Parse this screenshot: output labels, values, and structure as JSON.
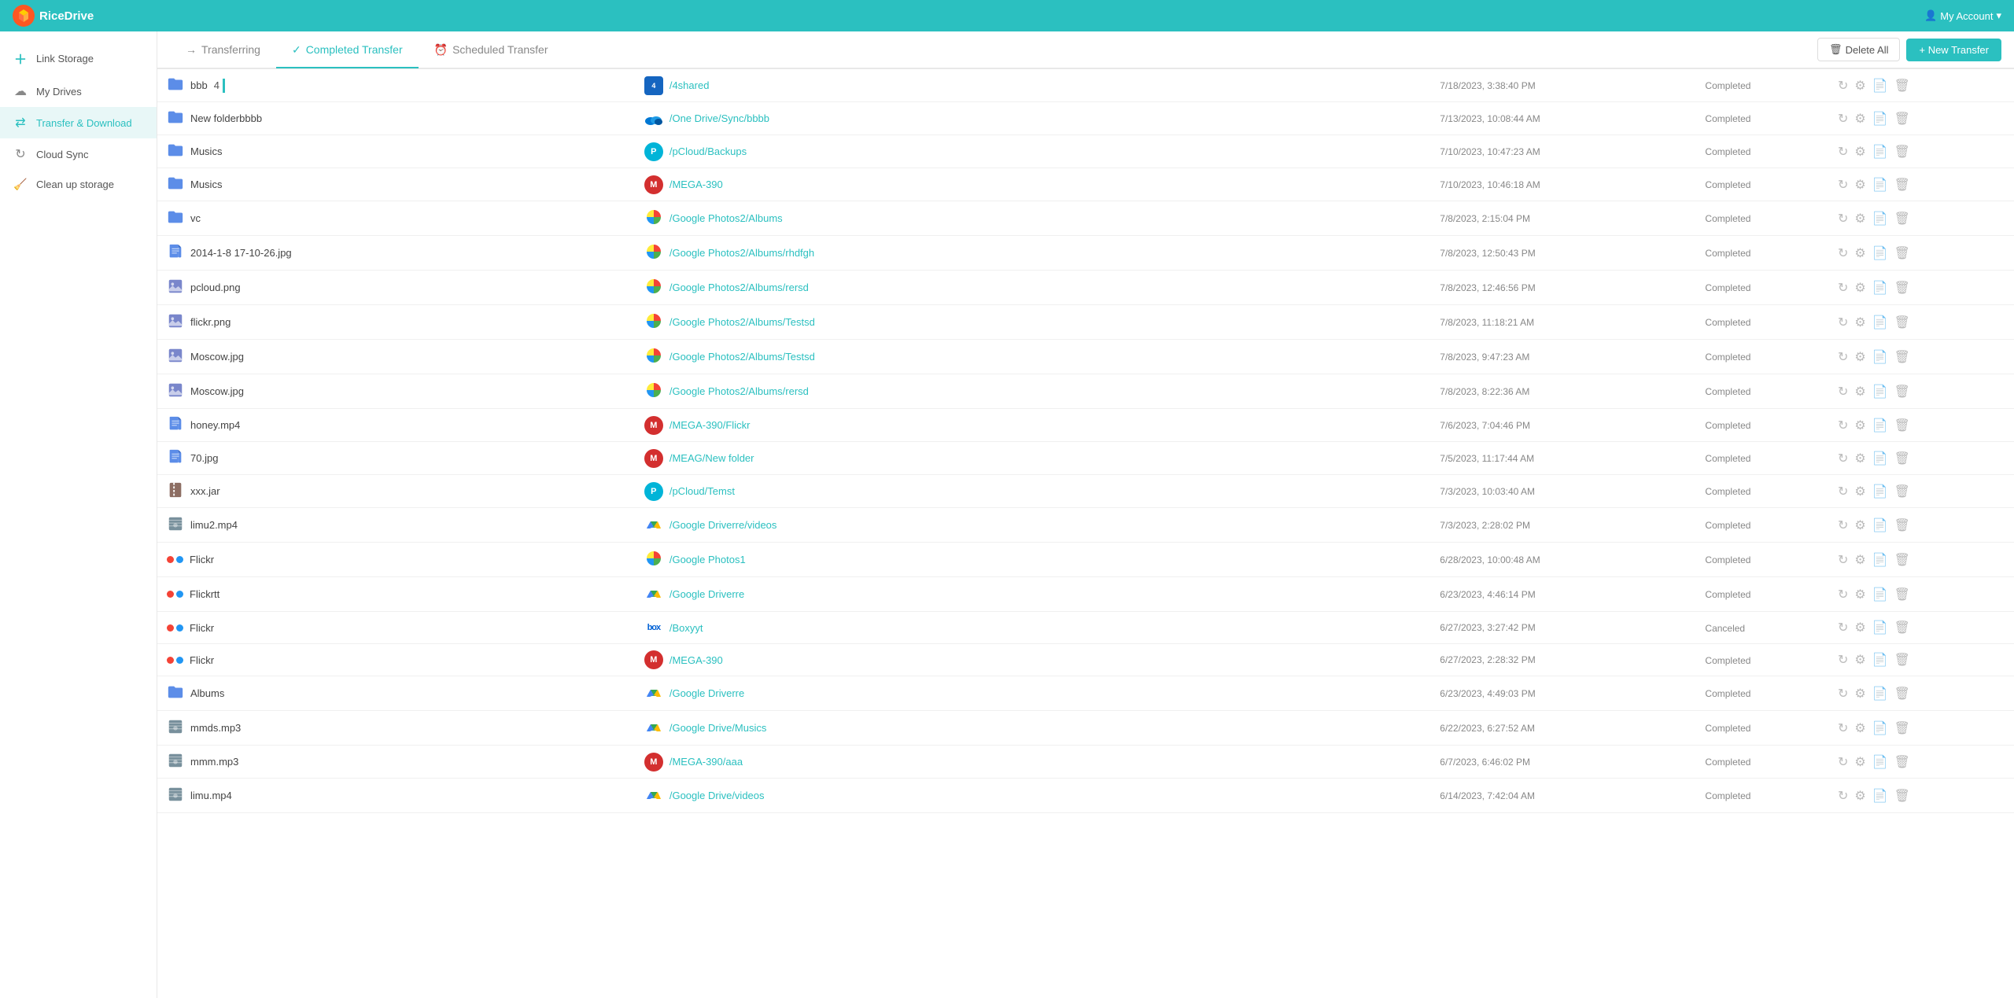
{
  "app": {
    "name": "RiceDrive",
    "account": "My Account"
  },
  "sidebar": {
    "items": [
      {
        "id": "link-storage",
        "label": "Link Storage",
        "icon": "+"
      },
      {
        "id": "my-drives",
        "label": "My Drives",
        "icon": "☁"
      },
      {
        "id": "transfer-download",
        "label": "Transfer & Download",
        "icon": "⇄",
        "active": true
      },
      {
        "id": "cloud-sync",
        "label": "Cloud Sync",
        "icon": "↻"
      },
      {
        "id": "clean-up",
        "label": "Clean up storage",
        "icon": "🧹"
      }
    ]
  },
  "tabs": [
    {
      "id": "transferring",
      "label": "Transferring",
      "icon": "→"
    },
    {
      "id": "completed",
      "label": "Completed Transfer",
      "icon": "✓",
      "active": true
    },
    {
      "id": "scheduled",
      "label": "Scheduled Transfer",
      "icon": "⏰"
    }
  ],
  "toolbar": {
    "delete_all": "Delete All",
    "new_transfer": "+ New Transfer"
  },
  "table": {
    "transfers": [
      {
        "id": 1,
        "type": "folder",
        "name": "bbb",
        "num": "4",
        "dest_service": "4shared",
        "dest_logo": "4s",
        "dest_color": "#1565c0",
        "dest_path": "/4shared",
        "date": "7/18/2023, 3:38:40 PM",
        "status": "Completed",
        "report": "green",
        "has_settings": true
      },
      {
        "id": 2,
        "type": "folder",
        "name": "New folderbbbb",
        "dest_service": "onedrive",
        "dest_logo": "OD",
        "dest_color": "#0078d4",
        "dest_path": "/One Drive/Sync/bbbb",
        "date": "7/13/2023, 10:08:44 AM",
        "status": "Completed",
        "report": "green"
      },
      {
        "id": 3,
        "type": "folder",
        "name": "Musics",
        "dest_service": "pcloud",
        "dest_logo": "P",
        "dest_color": "#00b4d8",
        "dest_path": "/pCloud/Backups",
        "date": "7/10/2023, 10:47:23 AM",
        "status": "Completed",
        "report": "green"
      },
      {
        "id": 4,
        "type": "folder",
        "name": "Musics",
        "dest_service": "mega",
        "dest_logo": "M",
        "dest_color": "#d32f2f",
        "dest_path": "/MEGA-390",
        "date": "7/10/2023, 10:46:18 AM",
        "status": "Completed",
        "report": "green"
      },
      {
        "id": 5,
        "type": "folder",
        "name": "vc",
        "dest_service": "googlephotos",
        "dest_logo": "GP",
        "dest_color": "#4285f4",
        "dest_path": "/Google Photos2/Albums",
        "date": "7/8/2023, 2:15:04 PM",
        "status": "Completed",
        "report": "green"
      },
      {
        "id": 6,
        "type": "file-doc",
        "name": "2014-1-8 17-10-26.jpg",
        "dest_service": "googlephotos",
        "dest_logo": "GP",
        "dest_color": "#4285f4",
        "dest_path": "/Google Photos2/Albums/rhdfgh",
        "date": "7/8/2023, 12:50:43 PM",
        "status": "Completed",
        "report": "green"
      },
      {
        "id": 7,
        "type": "file-img",
        "name": "pcloud.png",
        "dest_service": "googlephotos",
        "dest_logo": "GP",
        "dest_color": "#4285f4",
        "dest_path": "/Google Photos2/Albums/rersd",
        "date": "7/8/2023, 12:46:56 PM",
        "status": "Completed",
        "report": "green"
      },
      {
        "id": 8,
        "type": "file-img",
        "name": "flickr.png",
        "dest_service": "googlephotos",
        "dest_logo": "GP",
        "dest_color": "#4285f4",
        "dest_path": "/Google Photos2/Albums/Testsd",
        "date": "7/8/2023, 11:18:21 AM",
        "status": "Completed",
        "report": "green"
      },
      {
        "id": 9,
        "type": "file-img",
        "name": "Moscow.jpg",
        "dest_service": "googlephotos",
        "dest_logo": "GP",
        "dest_color": "#4285f4",
        "dest_path": "/Google Photos2/Albums/Testsd",
        "date": "7/8/2023, 9:47:23 AM",
        "status": "Completed",
        "report": "green"
      },
      {
        "id": 10,
        "type": "file-img",
        "name": "Moscow.jpg",
        "dest_service": "googlephotos",
        "dest_logo": "GP",
        "dest_color": "#4285f4",
        "dest_path": "/Google Photos2/Albums/rersd",
        "date": "7/8/2023, 8:22:36 AM",
        "status": "Completed",
        "report": "green"
      },
      {
        "id": 11,
        "type": "file-doc",
        "name": "honey.mp4",
        "dest_service": "mega",
        "dest_logo": "M",
        "dest_color": "#d32f2f",
        "dest_path": "/MEGA-390/Flickr",
        "date": "7/6/2023, 7:04:46 PM",
        "status": "Completed",
        "report": "green"
      },
      {
        "id": 12,
        "type": "file-doc",
        "name": "70.jpg",
        "dest_service": "mega",
        "dest_logo": "M",
        "dest_color": "#d32f2f",
        "dest_path": "/MEAG/New folder",
        "date": "7/5/2023, 11:17:44 AM",
        "status": "Completed",
        "report": "green"
      },
      {
        "id": 13,
        "type": "file-zip",
        "name": "xxx.jar",
        "dest_service": "pcloud",
        "dest_logo": "P",
        "dest_color": "#00b4d8",
        "dest_path": "/pCloud/Temst",
        "date": "7/3/2023, 10:03:40 AM",
        "status": "Completed",
        "report": "green"
      },
      {
        "id": 14,
        "type": "file-vid",
        "name": "limu2.mp4",
        "dest_service": "googledrive",
        "dest_logo": "GD",
        "dest_color": "#34a853",
        "dest_path": "/Google Driverre/videos",
        "date": "7/3/2023, 2:28:02 PM",
        "status": "Completed",
        "report": "green"
      },
      {
        "id": 15,
        "type": "multi",
        "name": "Flickr",
        "dest_service": "googlephotos",
        "dest_logo": "GP",
        "dest_color": "#4285f4",
        "dest_path": "/Google Photos1",
        "date": "6/28/2023, 10:00:48 AM",
        "status": "Completed",
        "report": "green"
      },
      {
        "id": 16,
        "type": "multi",
        "name": "Flickrtt",
        "dest_service": "googledrive",
        "dest_logo": "GD",
        "dest_color": "#34a853",
        "dest_path": "/Google Driverre",
        "date": "6/23/2023, 4:46:14 PM",
        "status": "Completed",
        "report": "green"
      },
      {
        "id": 17,
        "type": "multi",
        "name": "Flickr",
        "dest_service": "box",
        "dest_logo": "box",
        "dest_color": "#0061d5",
        "dest_path": "/Boxyyt",
        "date": "6/27/2023, 3:27:42 PM",
        "status": "Canceled",
        "report": "green"
      },
      {
        "id": 18,
        "type": "multi",
        "name": "Flickr",
        "dest_service": "mega",
        "dest_logo": "M",
        "dest_color": "#d32f2f",
        "dest_path": "/MEGA-390",
        "date": "6/27/2023, 2:28:32 PM",
        "status": "Completed",
        "report": "green"
      },
      {
        "id": 19,
        "type": "folder",
        "name": "Albums",
        "dest_service": "googledrive",
        "dest_logo": "GD",
        "dest_color": "#34a853",
        "dest_path": "/Google Driverre",
        "date": "6/23/2023, 4:49:03 PM",
        "status": "Completed",
        "report": "green"
      },
      {
        "id": 20,
        "type": "file-vid",
        "name": "mmds.mp3",
        "dest_service": "googledrive",
        "dest_logo": "GD",
        "dest_color": "#34a853",
        "dest_path": "/Google Drive/Musics",
        "date": "6/22/2023, 6:27:52 AM",
        "status": "Completed",
        "report": "green"
      },
      {
        "id": 21,
        "type": "file-vid",
        "name": "mmm.mp3",
        "dest_service": "mega",
        "dest_logo": "M",
        "dest_color": "#d32f2f",
        "dest_path": "/MEGA-390/aaa",
        "date": "6/7/2023, 6:46:02 PM",
        "status": "Completed",
        "report": "green"
      },
      {
        "id": 22,
        "type": "file-vid",
        "name": "limu.mp4",
        "dest_service": "googledrive",
        "dest_logo": "GD",
        "dest_color": "#34a853",
        "dest_path": "/Google Drive/videos",
        "date": "6/14/2023, 7:42:04 AM",
        "status": "Completed",
        "report": "orange"
      }
    ]
  }
}
